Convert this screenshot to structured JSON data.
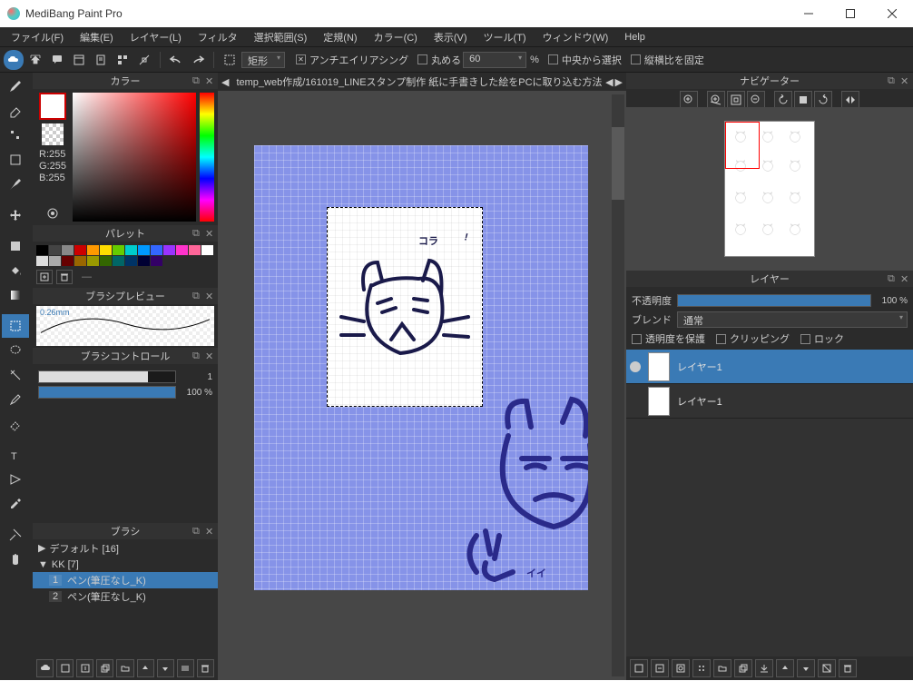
{
  "window": {
    "title": "MediBang Paint Pro"
  },
  "menu": [
    "ファイル(F)",
    "編集(E)",
    "レイヤー(L)",
    "フィルタ",
    "選択範囲(S)",
    "定規(N)",
    "カラー(C)",
    "表示(V)",
    "ツール(T)",
    "ウィンドウ(W)",
    "Help"
  ],
  "toolbar": {
    "shape": "矩形",
    "antialias": "アンチエイリアシング",
    "round": "丸める",
    "round_val": "60",
    "pct": "%",
    "center": "中央から選択",
    "aspect": "縦横比を固定"
  },
  "tab": {
    "path": "temp_web作成/161019_LINEスタンプ制作 紙に手書きした絵をPCに取り込む方法"
  },
  "panels": {
    "color": "カラー",
    "palette": "パレット",
    "brushpreview": "ブラシプレビュー",
    "brushcontrol": "ブラシコントロール",
    "brush": "ブラシ",
    "navigator": "ナビゲーター",
    "layer": "レイヤー"
  },
  "color": {
    "r": "R:255",
    "g": "G:255",
    "b": "B:255"
  },
  "palette_colors": [
    "#000",
    "#444",
    "#888",
    "#c00",
    "#f90",
    "#fd0",
    "#6c0",
    "#0cc",
    "#09f",
    "#36f",
    "#93f",
    "#f3c",
    "#f69",
    "#fff",
    "#ddd",
    "#aaa",
    "#600",
    "#960",
    "#990",
    "#360",
    "#066",
    "#036",
    "#003",
    "#306"
  ],
  "brush_preview": {
    "size": "0.26mm"
  },
  "brush_ctrl": {
    "v1": "1",
    "v2": "100 %"
  },
  "brush_groups": {
    "g1": "デフォルト [16]",
    "g2": "KK [7]",
    "b1_num": "1",
    "b1_name": "ペン(筆圧なし_K)",
    "b2_num": "2",
    "b2_name": "ペン(筆圧なし_K)"
  },
  "palette_sep": "—",
  "layer": {
    "opacity_label": "不透明度",
    "opacity_val": "100 %",
    "blend_label": "ブレンド",
    "blend_val": "通常",
    "protect": "透明度を保護",
    "clip": "クリッピング",
    "lock": "ロック",
    "l1": "レイヤー1",
    "l2": "レイヤー1"
  }
}
